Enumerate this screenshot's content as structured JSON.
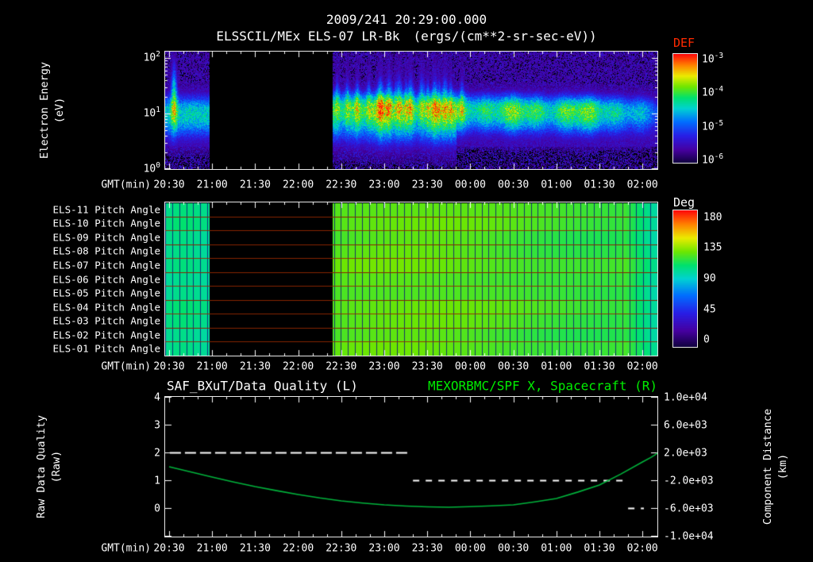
{
  "header": {
    "datetime": "2009/241 20:29:00.000",
    "instrument": "ELSSCIL/MEx ELS-07 LR-Bk",
    "units": "(ergs/(cm**2-sr-sec-eV))"
  },
  "time_axis": {
    "label": "GMT(min)",
    "ticks": [
      "20:30",
      "21:00",
      "21:30",
      "22:00",
      "22:30",
      "23:00",
      "23:30",
      "00:00",
      "00:30",
      "01:00",
      "01:30",
      "02:00"
    ],
    "minutes_per_tick": 30,
    "span_minutes": 343
  },
  "colors": {
    "background": "#000000",
    "axis_text": "#ffffff",
    "def_label": "#ff2a00",
    "right_title": "#00ee00",
    "curve": "#00b43c"
  },
  "chart_data": [
    {
      "type": "heatmap",
      "id": "electron-energy-spectrogram",
      "ylabel_lines": [
        "Electron Energy",
        "(eV)"
      ],
      "y_scale": "log",
      "y_range_ev": [
        1,
        130
      ],
      "yticks": [
        {
          "base": "10",
          "exp": "2"
        },
        {
          "base": "10",
          "exp": "1"
        },
        {
          "base": "10",
          "exp": "0"
        }
      ],
      "colorbar": {
        "label": "DEF",
        "ticks": [
          {
            "base": "10",
            "exp": "-3"
          },
          {
            "base": "10",
            "exp": "-4"
          },
          {
            "base": "10",
            "exp": "-5"
          },
          {
            "base": "10",
            "exp": "-6"
          }
        ]
      },
      "data_gap_minutes": [
        28,
        114
      ],
      "features": {
        "band_center_ev": 12,
        "band_range_ev": [
          4,
          35
        ],
        "burst_minute": 3,
        "bright_interval_minutes": [
          140,
          200
        ],
        "fading_after_minute": 305
      }
    },
    {
      "type": "heatmap",
      "id": "pitch-angle-panels",
      "rows": [
        "ELS-11 Pitch Angle",
        "ELS-10 Pitch Angle",
        "ELS-09 Pitch Angle",
        "ELS-08 Pitch Angle",
        "ELS-07 Pitch Angle",
        "ELS-06 Pitch Angle",
        "ELS-05 Pitch Angle",
        "ELS-04 Pitch Angle",
        "ELS-03 Pitch Angle",
        "ELS-02 Pitch Angle",
        "ELS-01 Pitch Angle"
      ],
      "colorbar": {
        "label": "Deg",
        "ticks": [
          "180",
          "135",
          "90",
          "45",
          "0"
        ]
      },
      "data_gap_minutes": [
        28,
        114
      ],
      "segments_deg": [
        {
          "t_min": -3,
          "t_max": 28,
          "deg": 103
        },
        {
          "t_min": 114,
          "t_max": 315,
          "deg": 120
        },
        {
          "t_min": 315,
          "t_max": 343,
          "deg": 95
        }
      ]
    },
    {
      "type": "line",
      "id": "quality-and-spacecraft-x",
      "left_title": "SAF_BXuT/Data Quality (L)",
      "right_title": "MEXORBMC/SPF X, Spacecraft (R)",
      "left_ylabel_lines": [
        "Raw Data Quality",
        "(Raw)"
      ],
      "right_ylabel_lines": [
        "Component Distance",
        "(km)"
      ],
      "left_yticks": [
        "4",
        "3",
        "2",
        "1",
        "0"
      ],
      "left_ylim": [
        -1,
        4
      ],
      "right_yticks": [
        "1.0e+04",
        "6.0e+03",
        "2.0e+03",
        "-2.0e+03",
        "-6.0e+03",
        "-1.0e+04"
      ],
      "right_ylim": [
        -10000,
        10000
      ],
      "quality_segments": [
        {
          "t": [
            0.5,
            168
          ],
          "value": 2
        },
        {
          "t": [
            170,
            318
          ],
          "value": 1
        },
        {
          "t": [
            320,
            331
          ],
          "value": 0
        }
      ],
      "spacecraft_x_km": {
        "t_min": [
          0,
          15,
          30,
          45,
          60,
          75,
          90,
          105,
          120,
          135,
          150,
          165,
          180,
          195,
          210,
          225,
          240,
          255,
          270,
          285,
          300,
          315,
          330,
          336,
          343
        ],
        "km": [
          -57,
          -800,
          -1543,
          -2250,
          -2914,
          -3500,
          -4057,
          -4550,
          -4971,
          -5280,
          -5543,
          -5720,
          -5829,
          -5886,
          -5800,
          -5690,
          -5543,
          -5120,
          -4629,
          -3700,
          -2686,
          -1100,
          629,
          1300,
          2200
        ]
      }
    }
  ]
}
